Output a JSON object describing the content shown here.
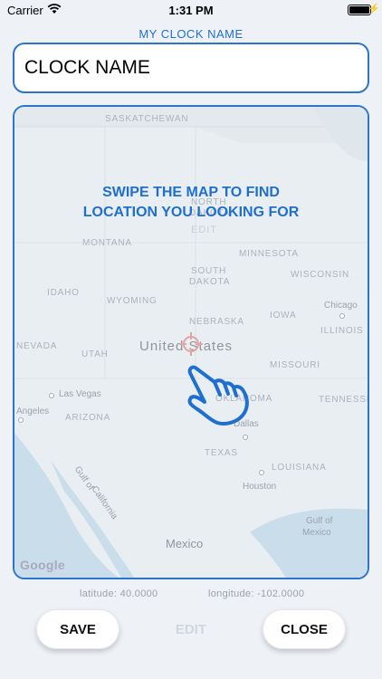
{
  "status_bar": {
    "carrier": "Carrier",
    "time": "1:31 PM"
  },
  "header": {
    "clock_label": "MY CLOCK NAME"
  },
  "name_field": {
    "value": "CLOCK NAME"
  },
  "map": {
    "instruction_line1": "SWIPE THE MAP TO FIND",
    "instruction_line2": "LOCATION YOU LOOKING FOR",
    "labels": {
      "saskatchewan": "SASKATCHEWAN",
      "north_dakota_1": "NORTH",
      "north_dakota_2": "DAKOTA",
      "montana": "MONTANA",
      "minnesota": "MINNESOTA",
      "south_dakota_1": "SOUTH",
      "south_dakota_2": "DAKOTA",
      "wisconsin": "WISCONSIN",
      "idaho": "IDAHO",
      "wyoming": "WYOMING",
      "nebraska": "NEBRASKA",
      "iowa": "IOWA",
      "illinois": "ILLINOIS",
      "nevada": "NEVADA",
      "utah": "UTAH",
      "missouri": "MISSOURI",
      "oklahoma": "OKLAHOMA",
      "tennessee": "TENNESSEE",
      "arizona": "ARIZONA",
      "texas": "TEXAS",
      "louisiana": "LOUISIANA",
      "country": "United States",
      "mexico": "Mexico",
      "gulf_of_california_1": "Gulf of",
      "gulf_of_california_2": "California",
      "gulf_of_mexico_1": "Gulf of",
      "gulf_of_mexico_2": "Mexico",
      "chicago": "Chicago",
      "las_vegas": "Las Vegas",
      "angeles": "Angeles",
      "dallas": "Dallas",
      "houston": "Houston",
      "edit": "EDIT"
    },
    "attribution": "Google",
    "icons": [
      "crosshair-icon",
      "swipe-hand-icon"
    ]
  },
  "coordinates": {
    "latitude": "latitude: 40.0000",
    "longitude": "longitude: -102.0000"
  },
  "buttons": {
    "save": "SAVE",
    "edit": "EDIT",
    "close": "CLOSE"
  },
  "colors": {
    "accent": "#2c74cc",
    "instruction": "#1f6fd0",
    "crosshair": "#e3a4a4"
  }
}
